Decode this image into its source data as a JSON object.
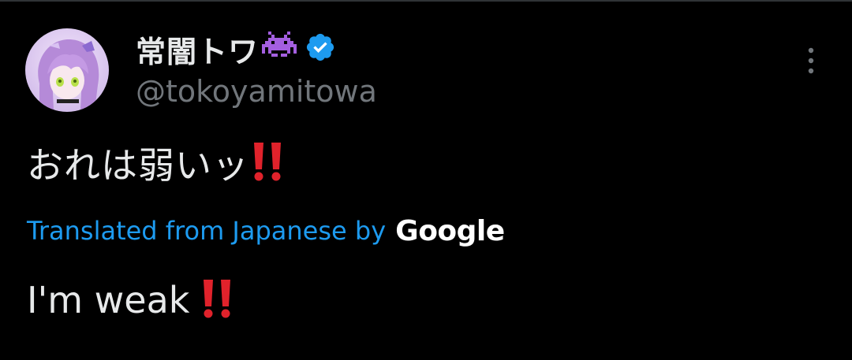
{
  "author": {
    "display_name": "常闇トワ",
    "name_emoji_icon": "alien-monster-emoji-icon",
    "verified_icon": "verified-badge-icon",
    "handle": "@tokoyamitowa"
  },
  "tweet": {
    "text": "おれは弱いッ",
    "text_emoji_icon": "double-exclamation-emoji-icon"
  },
  "translation": {
    "link_label": "Translated from Japanese by",
    "provider": "Google",
    "text": "I'm weak",
    "text_emoji_icon": "double-exclamation-emoji-icon"
  },
  "actions": {
    "more_icon": "more-vertical-icon"
  },
  "colors": {
    "background": "#000000",
    "primary_text": "#e7e9ea",
    "secondary_text": "#71767b",
    "link": "#1d9bf0",
    "verified": "#1d9bf0",
    "exclaim": "#e0222b",
    "invader": "#a45fe0"
  }
}
